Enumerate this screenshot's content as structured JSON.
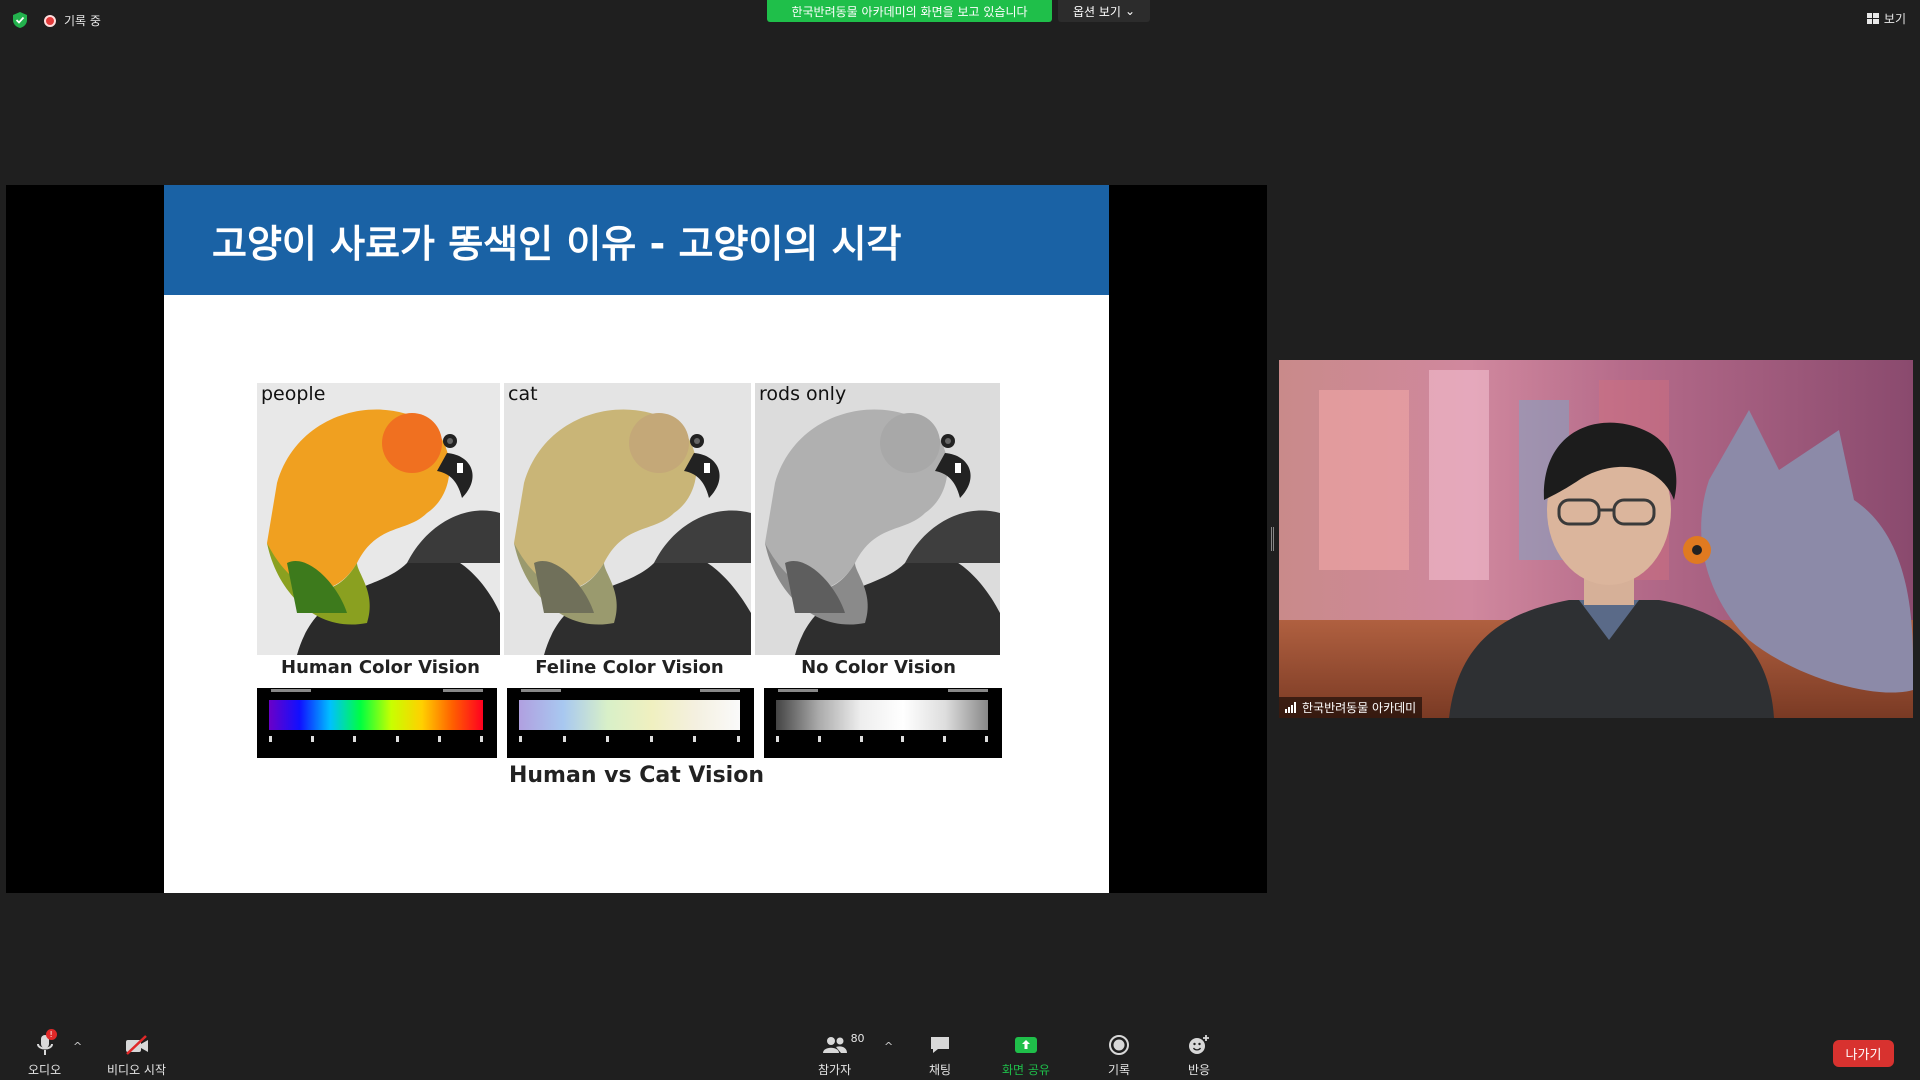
{
  "top_bar": {
    "recording_label": "기록 중",
    "share_banner": "한국반려동물 아카데미의 화면을 보고 있습니다",
    "view_options_label": "옵션 보기",
    "view_label": "보기"
  },
  "slide": {
    "title": "고양이 사료가 똥색인 이유 - 고양이의 시각",
    "panels": [
      {
        "label": "people",
        "caption": "Human Color Vision"
      },
      {
        "label": "cat",
        "caption": "Feline Color Vision"
      },
      {
        "label": "rods only",
        "caption": "No Color Vision"
      }
    ],
    "footer": "Human vs Cat Vision"
  },
  "video": {
    "participant_name": "한국반려동물 아카데미"
  },
  "toolbar": {
    "audio_label": "오디오",
    "audio_badge": "!",
    "video_label": "비디오 시작",
    "participants_label": "참가자",
    "participants_count": "80",
    "chat_label": "채팅",
    "share_label": "화면 공유",
    "record_label": "기록",
    "reactions_label": "반응",
    "leave_label": "나가기"
  },
  "colors": {
    "share_green": "#1fbf4a",
    "slide_header_blue": "#1a62a5",
    "leave_red": "#d8322f",
    "background": "#1f1f1f"
  }
}
